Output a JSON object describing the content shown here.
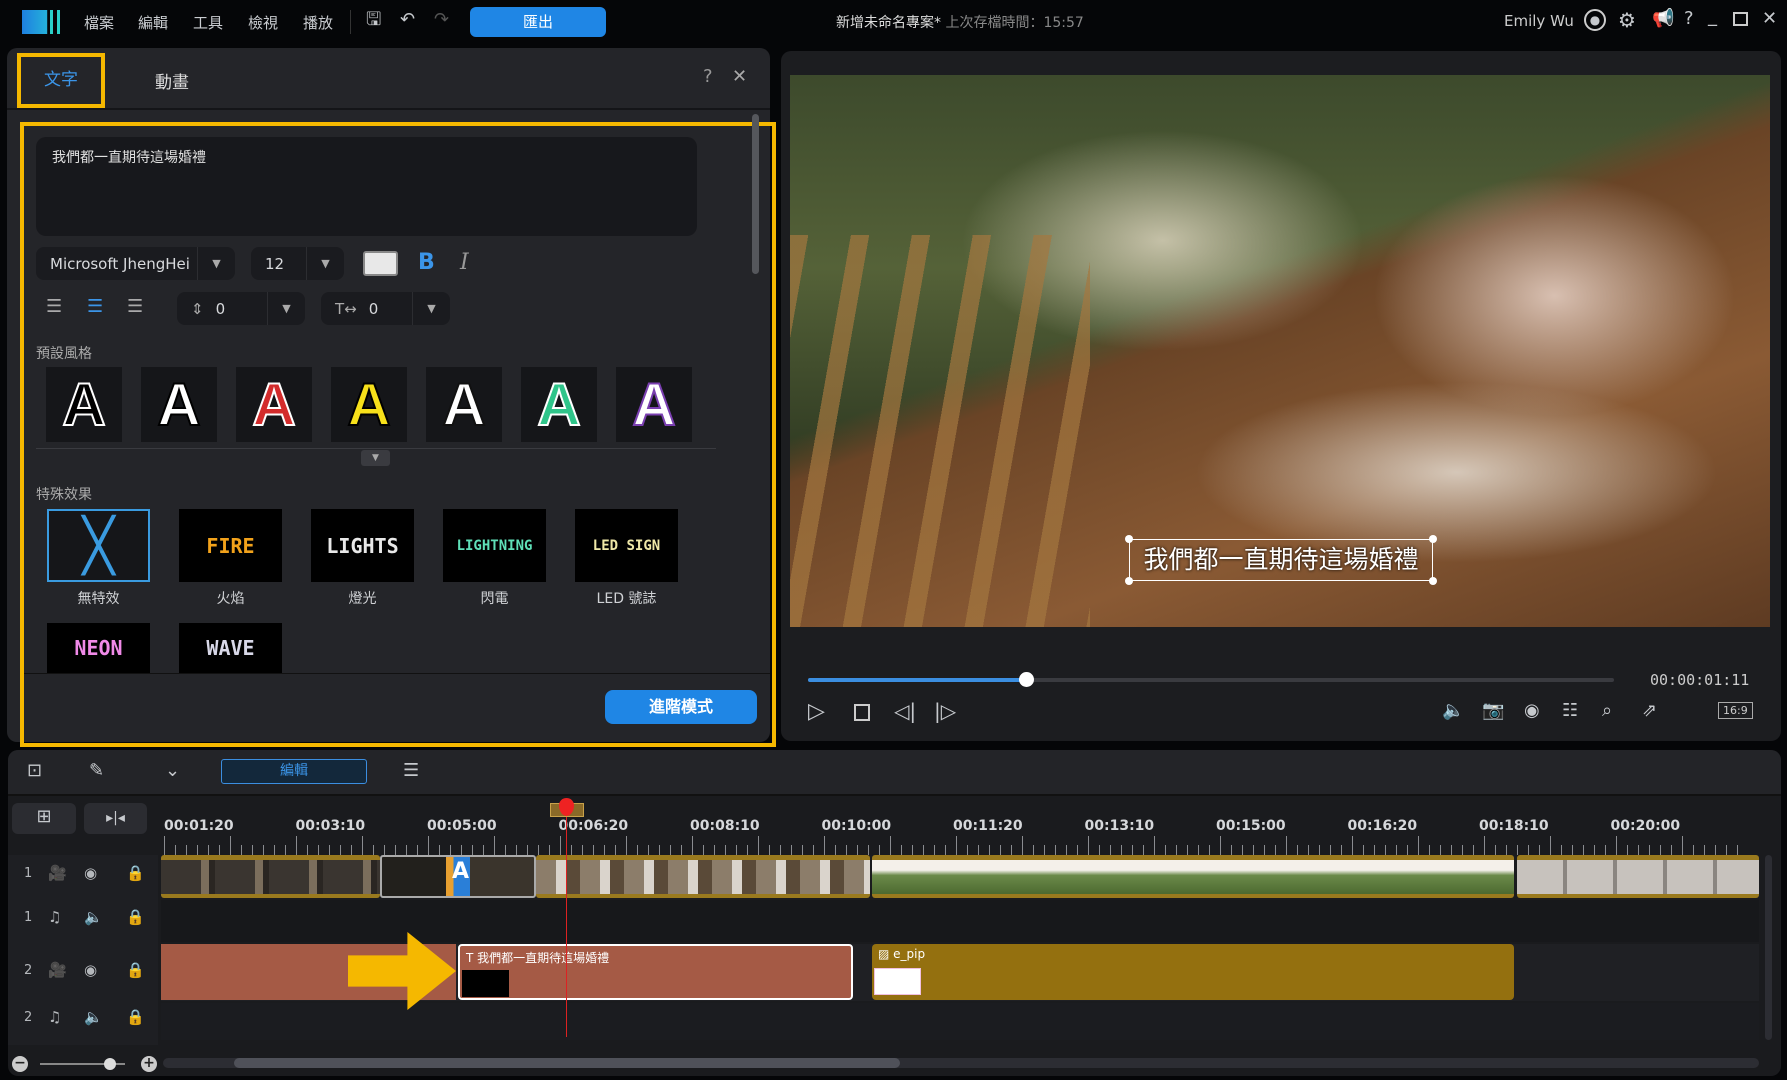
{
  "topbar": {
    "menus": [
      "檔案",
      "編輯",
      "工具",
      "檢視",
      "播放"
    ],
    "export_label": "匯出",
    "project_title": "新增未命名專案*",
    "save_time": "上次存檔時間：15:57",
    "user": "Emily Wu"
  },
  "text_panel": {
    "tabs": [
      "文字",
      "動畫"
    ],
    "active_tab": "文字",
    "text_value": "我們都一直期待這場婚禮",
    "font": "Microsoft JhengHei",
    "size": "12",
    "line_spacing": "0",
    "char_spacing": "0",
    "bold_label": "B",
    "italic_label": "I",
    "preset_label": "預設風格",
    "preset_letter": "A",
    "presets": [
      {
        "fill": "#000000",
        "stroke": "#ffffff"
      },
      {
        "fill": "#ffffff",
        "stroke": "#000000"
      },
      {
        "fill": "#d32b2b",
        "stroke": "#ffffff"
      },
      {
        "fill": "#f7e01a",
        "stroke": "#000000"
      },
      {
        "fill": "#ffffff",
        "stroke": "#111111"
      },
      {
        "fill": "#2fc58a",
        "stroke": "#ffffff"
      },
      {
        "fill": "#ffffff",
        "stroke": "#7a3fb0"
      }
    ],
    "effects_label": "特殊效果",
    "effects": [
      {
        "thumb": "",
        "label": "無特效",
        "color": "#3a9be0"
      },
      {
        "thumb": "FIRE",
        "label": "火焰",
        "color": "#f2a21b"
      },
      {
        "thumb": "LIGHTS",
        "label": "燈光",
        "color": "#e8e8e8"
      },
      {
        "thumb": "LIGHTNING",
        "label": "閃電",
        "color": "#5fe0b8"
      },
      {
        "thumb": "LED SIGN",
        "label": "LED 號誌",
        "color": "#efe8a8"
      },
      {
        "thumb": "NEON",
        "label": "",
        "color": "#f08ae8"
      },
      {
        "thumb": "WAVE",
        "label": "",
        "color": "#d8d8e8"
      }
    ],
    "advanced_label": "進階模式"
  },
  "preview": {
    "subtitle": "我們都一直期待這場婚禮",
    "timecode": "00:00:01:11",
    "progress_percent": 27,
    "aspect": "16:9"
  },
  "timeline": {
    "edit_label": "編輯",
    "ruler": [
      "00:01:20",
      "00:03:10",
      "00:05:00",
      "00:06:20",
      "00:08:10",
      "00:10:00",
      "00:11:20",
      "00:13:10",
      "00:15:00",
      "00:16:20",
      "00:18:10",
      "00:20:00"
    ],
    "tracks": [
      "1",
      "1",
      "2",
      "2"
    ],
    "text_clip": "我們都一直期待這場婚禮",
    "pip_clip": "e_pip"
  },
  "colors": {
    "accent": "#1f86e5",
    "highlight": "#f5b800",
    "text_clip": "#a55a45",
    "pip_clip": "#94700f"
  }
}
